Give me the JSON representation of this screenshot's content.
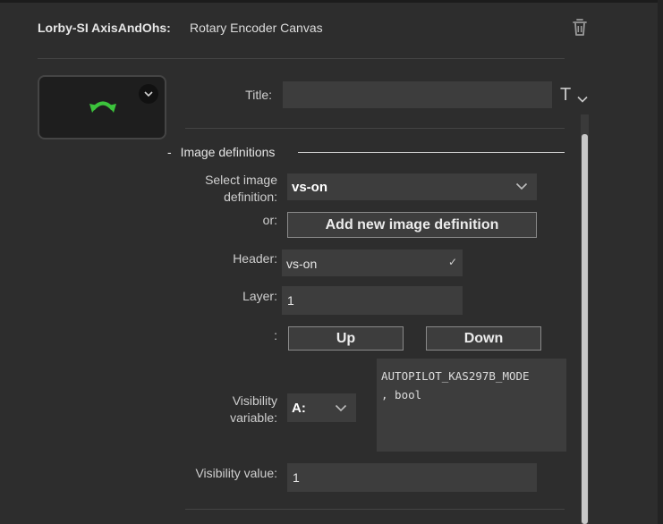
{
  "header": {
    "plugin_name": "Lorby-SI AxisAndOhs:",
    "action_name": "Rotary Encoder Canvas"
  },
  "icons": {
    "delete": "trash-icon",
    "preview": "rotary-arrow-icon",
    "title_font": "text-format-icon"
  },
  "colors": {
    "background": "#2d2d2d",
    "field": "#3d3d3d",
    "rotary_icon": "#3cc33c"
  },
  "title_field": {
    "label": "Title:",
    "value": "",
    "font_button": "T"
  },
  "image_definitions": {
    "toggle": "-",
    "title": "Image definitions",
    "select_label_line1": "Select image",
    "select_label_line2": "definition:",
    "selected": "vs-on",
    "or_label": "or:",
    "add_button": "Add new image definition",
    "header_label": "Header:",
    "header_value": "vs-on",
    "header_confirm": "✓",
    "layer_label": "Layer:",
    "layer_value": "1",
    "order_label": ":",
    "up_button": "Up",
    "down_button": "Down",
    "visibility_label_line1": "Visibility",
    "visibility_label_line2": "variable:",
    "variable_type": "A:",
    "variable_text": "AUTOPILOT_KAS297B_MODE\n, bool",
    "visibility_value_label": "Visibility value:",
    "visibility_value": "1"
  }
}
